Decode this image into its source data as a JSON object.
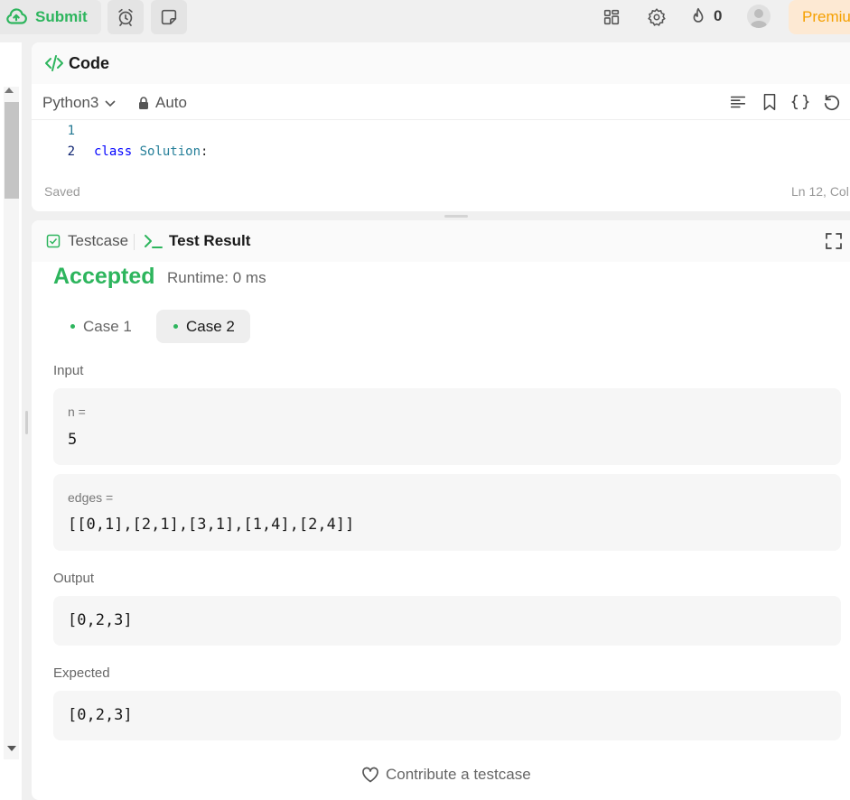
{
  "topbar": {
    "submit_label": "Submit",
    "streak_count": "0",
    "premium_label": "Premiu"
  },
  "code_panel": {
    "title": "Code",
    "language": "Python3",
    "mode": "Auto",
    "lines": [
      {
        "number": "1",
        "text": ""
      },
      {
        "number": "2",
        "keyword": "class",
        "name": "Solution",
        "rest": ":"
      }
    ],
    "status_saved": "Saved",
    "cursor_position": "Ln 12, Col"
  },
  "result_panel": {
    "tabs": [
      {
        "label": "Testcase"
      },
      {
        "label": "Test Result"
      }
    ],
    "verdict": "Accepted",
    "runtime": "Runtime: 0 ms",
    "cases": [
      {
        "label": "Case 1"
      },
      {
        "label": "Case 2",
        "selected": true
      }
    ],
    "input_label": "Input",
    "inputs": [
      {
        "name": "n =",
        "value": "5"
      },
      {
        "name": "edges =",
        "value": "[[0,1],[2,1],[3,1],[1,4],[2,4]]"
      }
    ],
    "output_label": "Output",
    "output_value": "[0,2,3]",
    "expected_label": "Expected",
    "expected_value": "[0,2,3]",
    "contribute_label": "Contribute a testcase"
  },
  "colors": {
    "accent_green": "#2db55d",
    "premium_orange": "#f5a000"
  }
}
